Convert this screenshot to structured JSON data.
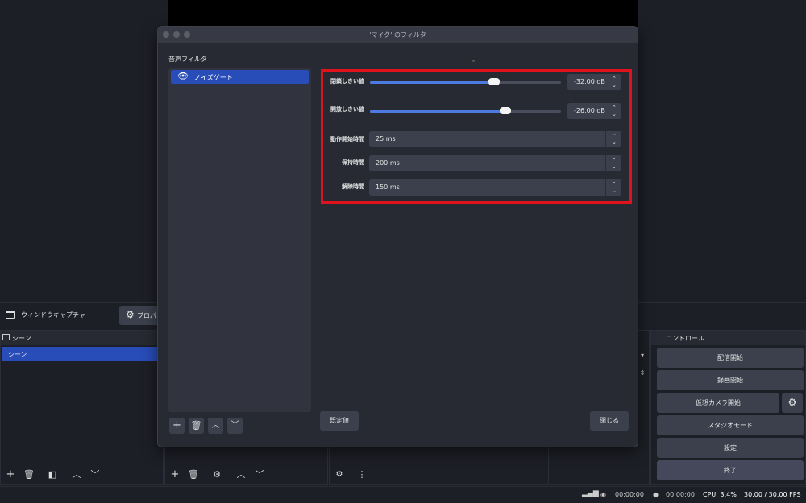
{
  "dialog": {
    "title": "'マイク' のフィルタ",
    "section_label": "音声フィルタ",
    "filters": [
      {
        "label": "ノイズゲート",
        "icon": "eye-icon"
      }
    ],
    "properties": {
      "close_threshold": {
        "label": "閉鎖しきい値",
        "value": "-32.00 dB",
        "slider_fraction": 0.65
      },
      "open_threshold": {
        "label": "開放しきい値",
        "value": "-26.00 dB",
        "slider_fraction": 0.71
      },
      "attack_time": {
        "label": "動作開始時間",
        "value": "25 ms"
      },
      "hold_time": {
        "label": "保持時間",
        "value": "200 ms"
      },
      "release_time": {
        "label": "解除時間",
        "value": "150 ms"
      }
    },
    "defaults_button": "既定値",
    "close_button": "閉じる"
  },
  "source_bar": {
    "name": "ウィンドウキャプチャ",
    "properties_button": "プロパ"
  },
  "scenes": {
    "title": "シーン",
    "items": [
      "シーン"
    ]
  },
  "controls": {
    "title": "コントロール",
    "buttons": [
      "配信開始",
      "録画開始",
      "仮想カメラ開始",
      "スタジオモード",
      "設定",
      "終了"
    ]
  },
  "status": {
    "stream_time": "00:00:00",
    "record_time": "00:00:00",
    "cpu": "CPU: 3.4%",
    "fps": "30.00 / 30.00 FPS"
  },
  "colors": {
    "accent": "#284cb8",
    "highlight_border": "#e0121b",
    "slider_fill": "#4c7ae0"
  }
}
